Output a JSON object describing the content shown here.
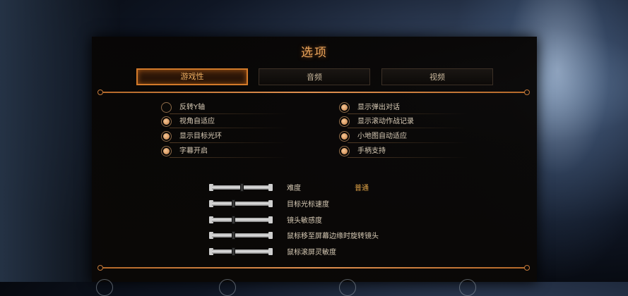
{
  "title": "选项",
  "tabs": [
    {
      "label": "游戏性",
      "active": true
    },
    {
      "label": "音频",
      "active": false
    },
    {
      "label": "视频",
      "active": false
    }
  ],
  "options_left": [
    {
      "label": "反转Y轴",
      "checked": false
    },
    {
      "label": "视角自适应",
      "checked": true
    },
    {
      "label": "显示目标光环",
      "checked": true
    },
    {
      "label": "字幕开启",
      "checked": true
    }
  ],
  "options_right": [
    {
      "label": "显示弹出对话",
      "checked": true
    },
    {
      "label": "显示滚动作战记录",
      "checked": true
    },
    {
      "label": "小地图自动适应",
      "checked": true
    },
    {
      "label": "手柄支持",
      "checked": true
    }
  ],
  "sliders": [
    {
      "label": "难度",
      "value_text": "普通",
      "level": 0.52
    },
    {
      "label": "目标光标速度",
      "value_text": "",
      "level": 0.38
    },
    {
      "label": "镜头敏感度",
      "value_text": "",
      "level": 0.38
    },
    {
      "label": "鼠标移至屏幕边缘时旋转镜头",
      "value_text": "",
      "level": 0.38
    },
    {
      "label": "鼠标滚屏灵敏度",
      "value_text": "",
      "level": 0.38
    }
  ],
  "colors": {
    "accent": "#d27a2a",
    "title": "#e8a35a",
    "value": "#e0a347"
  }
}
